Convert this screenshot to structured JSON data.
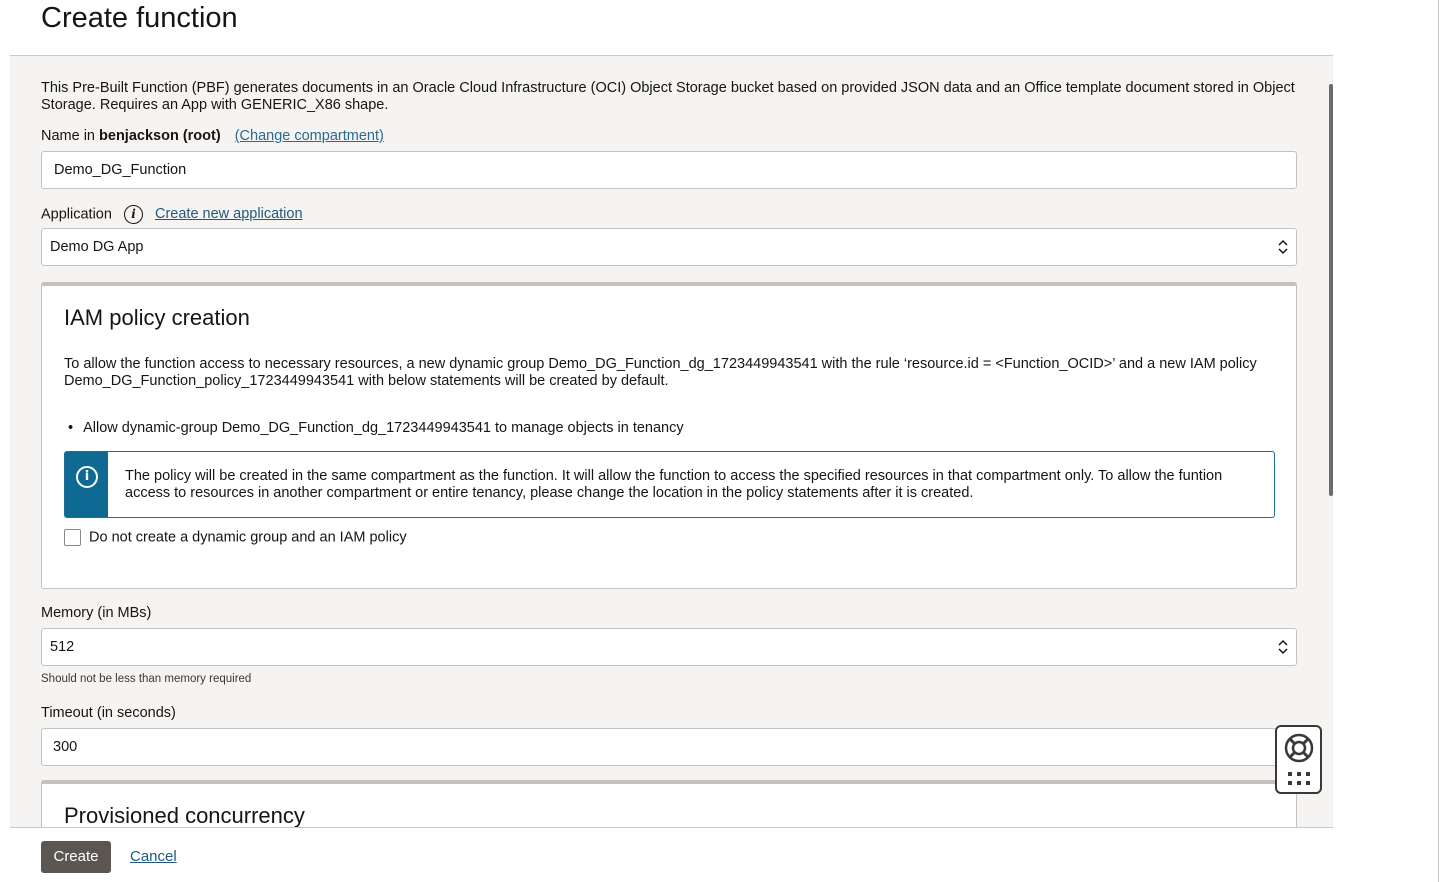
{
  "header": {
    "title": "Create function"
  },
  "description": "This Pre-Built Function (PBF) generates documents in an Oracle Cloud Infrastructure (OCI) Object Storage bucket based on provided JSON data and an Office template document stored in Object Storage. Requires an App with GENERIC_X86 shape.",
  "name_field": {
    "label_prefix": "Name in",
    "compartment": "benjackson (root)",
    "change_compartment_link": "(Change compartment)",
    "value": "Demo_DG_Function"
  },
  "application": {
    "label": "Application",
    "info_icon": "info-icon",
    "create_link": "Create new application",
    "selected": "Demo DG App"
  },
  "iam": {
    "title": "IAM policy creation",
    "text": "To allow the function access to necessary resources, a new dynamic group Demo_DG_Function_dg_1723449943541 with the rule ‘resource.id = <Function_OCID>’ and a new IAM policy Demo_DG_Function_policy_1723449943541 with below statements will be created by default.",
    "statement": "Allow dynamic-group Demo_DG_Function_dg_1723449943541 to manage objects in tenancy",
    "notice": "The policy will be created in the same compartment as the function. It will allow the function to access the specified resources in that compartment only. To allow the funtion access to resources in another compartment or entire tenancy, please change the location in the policy statements after it is created.",
    "checkbox_label": "Do not create a dynamic group and an IAM policy",
    "checkbox_checked": false
  },
  "memory": {
    "label": "Memory (in MBs)",
    "value": "512",
    "hint": "Should not be less than memory required"
  },
  "timeout": {
    "label": "Timeout (in seconds)",
    "value": "300"
  },
  "provisioned": {
    "title": "Provisioned concurrency"
  },
  "footer": {
    "create_label": "Create",
    "cancel_label": "Cancel"
  },
  "colors": {
    "primary_button": "#5b5652",
    "link": "#1f5a7a",
    "notice_accent": "#0f6a93",
    "panel_bg": "#f5f4f2"
  }
}
